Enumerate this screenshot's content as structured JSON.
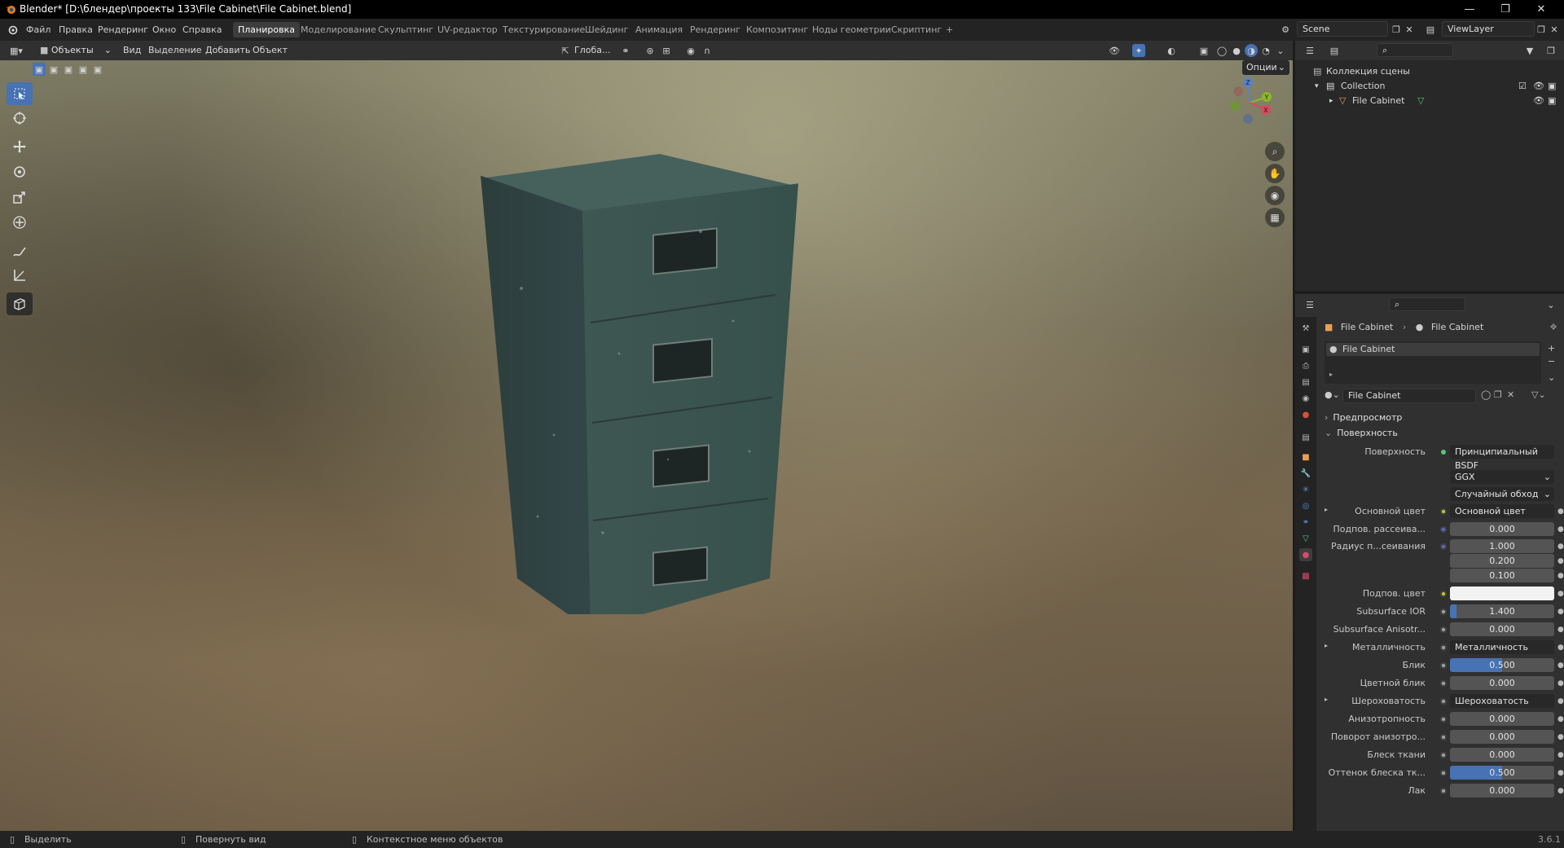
{
  "window": {
    "title": "Blender* [D:\\блендер\\проекты 133\\File Cabinet\\File Cabinet.blend]"
  },
  "menu": [
    "Файл",
    "Правка",
    "Рендеринг",
    "Окно",
    "Справка"
  ],
  "workspaces": [
    {
      "label": "Планировка",
      "active": true
    },
    {
      "label": "Моделирование"
    },
    {
      "label": "Скульптинг"
    },
    {
      "label": "UV-редактор"
    },
    {
      "label": "Текстурирование"
    },
    {
      "label": "Шейдинг"
    },
    {
      "label": "Анимация"
    },
    {
      "label": "Рендеринг"
    },
    {
      "label": "Композитинг"
    },
    {
      "label": "Ноды геометрии"
    },
    {
      "label": "Скриптинг"
    },
    {
      "label": "+"
    }
  ],
  "scene": "Scene",
  "viewlayer": "ViewLayer",
  "viewport_header": {
    "mode": "Объекты",
    "items": [
      "Вид",
      "Выделение",
      "Добавить",
      "Объект"
    ],
    "transform": "Глоба...",
    "options": "Опции"
  },
  "gizmo": {
    "z": "Z",
    "y": "Y",
    "x": "X"
  },
  "outliner": {
    "root": "Коллекция сцены",
    "collection": "Collection",
    "object": "File Cabinet"
  },
  "properties": {
    "breadcrumb_object": "File Cabinet",
    "breadcrumb_material": "File Cabinet",
    "slot": "File Cabinet",
    "material_name": "File Cabinet",
    "sections": {
      "preview": "Предпросмотр",
      "surface": "Поверхность"
    },
    "surface_label": "Поверхность",
    "surface_value": "Принципиальный BSDF",
    "distribution": "GGX",
    "subsurface_method": "Случайный обход",
    "rows": [
      {
        "label": "Основной цвет",
        "link": "Основной цвет",
        "expand": true,
        "dot": "#c7c729"
      },
      {
        "label": "Подпов. рассеива...",
        "value": "0.000",
        "dot": "#6363c7"
      },
      {
        "label": "Радиус п...сеивания",
        "value": "1.000",
        "dot": "#6363c7"
      },
      {
        "label": "",
        "value": "0.200"
      },
      {
        "label": "",
        "value": "0.100"
      },
      {
        "label": "Подпов. цвет",
        "swatch": "#f2f2f2",
        "dot": "#c7c729"
      },
      {
        "label": "Subsurface IOR",
        "value": "1.400",
        "fill": 0.06,
        "dot": "#a1a1a1"
      },
      {
        "label": "Subsurface Anisotr...",
        "value": "0.000",
        "dot": "#a1a1a1"
      },
      {
        "label": "Металличность",
        "link": "Металличность",
        "expand": true,
        "dot": "#a1a1a1"
      },
      {
        "label": "Блик",
        "value": "0.500",
        "fill": 0.5,
        "dot": "#a1a1a1"
      },
      {
        "label": "Цветной блик",
        "value": "0.000",
        "dot": "#a1a1a1"
      },
      {
        "label": "Шероховатость",
        "link": "Шероховатость",
        "expand": true,
        "dot": "#a1a1a1"
      },
      {
        "label": "Анизотропность",
        "value": "0.000",
        "dot": "#a1a1a1"
      },
      {
        "label": "Поворот анизотро...",
        "value": "0.000",
        "dot": "#a1a1a1"
      },
      {
        "label": "Блеск ткани",
        "value": "0.000",
        "dot": "#a1a1a1"
      },
      {
        "label": "Оттенок блеска тк...",
        "value": "0.500",
        "fill": 0.5,
        "dot": "#a1a1a1"
      },
      {
        "label": "Лак",
        "value": "0.000",
        "dot": "#a1a1a1"
      }
    ]
  },
  "statusbar": {
    "select": "Выделить",
    "rotate": "Повернуть вид",
    "context": "Контекстное меню объектов",
    "version": "3.6.1"
  },
  "colors": {
    "accent": "#4772b3",
    "header_bg": "#303030",
    "panel_bg": "#282828"
  }
}
